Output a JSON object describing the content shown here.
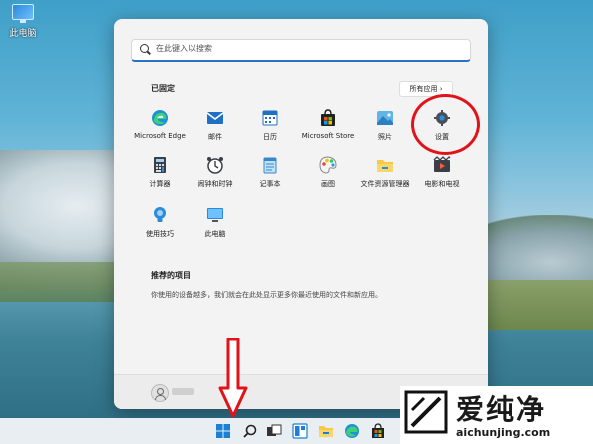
{
  "desktop": {
    "icon_label": "此电脑"
  },
  "start_menu": {
    "search": {
      "placeholder": "在此键入以搜索"
    },
    "pinned": {
      "title": "已固定",
      "all_apps_label": "所有应用",
      "all_apps_chevron": "›",
      "apps": [
        {
          "label": "Microsoft Edge",
          "icon": "edge-icon"
        },
        {
          "label": "邮件",
          "icon": "mail-icon"
        },
        {
          "label": "日历",
          "icon": "calendar-icon"
        },
        {
          "label": "Microsoft Store",
          "icon": "store-icon"
        },
        {
          "label": "照片",
          "icon": "photos-icon"
        },
        {
          "label": "设置",
          "icon": "settings-gear-icon"
        },
        {
          "label": "计算器",
          "icon": "calculator-icon"
        },
        {
          "label": "闹钟和时钟",
          "icon": "alarm-clock-icon"
        },
        {
          "label": "记事本",
          "icon": "notepad-icon"
        },
        {
          "label": "画图",
          "icon": "paint-icon"
        },
        {
          "label": "文件资源管理器",
          "icon": "file-explorer-icon"
        },
        {
          "label": "电影和电视",
          "icon": "movies-tv-icon"
        },
        {
          "label": "使用技巧",
          "icon": "tips-icon"
        },
        {
          "label": "此电脑",
          "icon": "this-pc-icon"
        }
      ]
    },
    "recommended": {
      "title": "推荐的项目",
      "text": "你使用的设备越多，我们就会在此处显示更多你最近使用的文件和新应用。"
    }
  },
  "taskbar": {
    "items": [
      "start-icon",
      "search-icon",
      "task-view-icon",
      "widgets-icon",
      "file-explorer-icon",
      "edge-icon",
      "store-icon"
    ]
  },
  "watermark": {
    "brand_cn": "爱纯净",
    "url": "aichunjing.com"
  },
  "colors": {
    "annotation_red": "#e0131a",
    "accent_blue": "#2b6fc7"
  }
}
